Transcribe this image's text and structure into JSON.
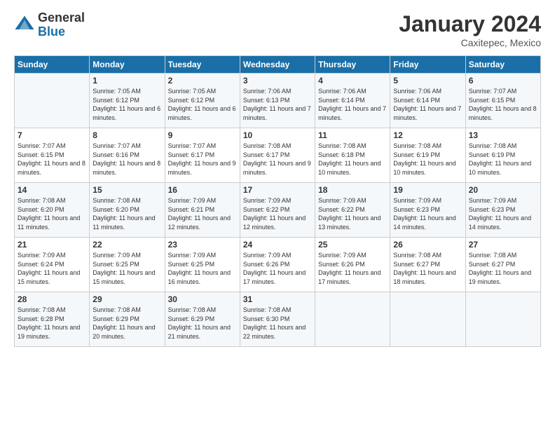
{
  "header": {
    "logo_general": "General",
    "logo_blue": "Blue",
    "month_title": "January 2024",
    "location": "Caxitepec, Mexico"
  },
  "weekdays": [
    "Sunday",
    "Monday",
    "Tuesday",
    "Wednesday",
    "Thursday",
    "Friday",
    "Saturday"
  ],
  "weeks": [
    [
      {
        "day": "",
        "sunrise": "",
        "sunset": "",
        "daylight": ""
      },
      {
        "day": "1",
        "sunrise": "Sunrise: 7:05 AM",
        "sunset": "Sunset: 6:12 PM",
        "daylight": "Daylight: 11 hours and 6 minutes."
      },
      {
        "day": "2",
        "sunrise": "Sunrise: 7:05 AM",
        "sunset": "Sunset: 6:12 PM",
        "daylight": "Daylight: 11 hours and 6 minutes."
      },
      {
        "day": "3",
        "sunrise": "Sunrise: 7:06 AM",
        "sunset": "Sunset: 6:13 PM",
        "daylight": "Daylight: 11 hours and 7 minutes."
      },
      {
        "day": "4",
        "sunrise": "Sunrise: 7:06 AM",
        "sunset": "Sunset: 6:14 PM",
        "daylight": "Daylight: 11 hours and 7 minutes."
      },
      {
        "day": "5",
        "sunrise": "Sunrise: 7:06 AM",
        "sunset": "Sunset: 6:14 PM",
        "daylight": "Daylight: 11 hours and 7 minutes."
      },
      {
        "day": "6",
        "sunrise": "Sunrise: 7:07 AM",
        "sunset": "Sunset: 6:15 PM",
        "daylight": "Daylight: 11 hours and 8 minutes."
      }
    ],
    [
      {
        "day": "7",
        "sunrise": "Sunrise: 7:07 AM",
        "sunset": "Sunset: 6:15 PM",
        "daylight": "Daylight: 11 hours and 8 minutes."
      },
      {
        "day": "8",
        "sunrise": "Sunrise: 7:07 AM",
        "sunset": "Sunset: 6:16 PM",
        "daylight": "Daylight: 11 hours and 8 minutes."
      },
      {
        "day": "9",
        "sunrise": "Sunrise: 7:07 AM",
        "sunset": "Sunset: 6:17 PM",
        "daylight": "Daylight: 11 hours and 9 minutes."
      },
      {
        "day": "10",
        "sunrise": "Sunrise: 7:08 AM",
        "sunset": "Sunset: 6:17 PM",
        "daylight": "Daylight: 11 hours and 9 minutes."
      },
      {
        "day": "11",
        "sunrise": "Sunrise: 7:08 AM",
        "sunset": "Sunset: 6:18 PM",
        "daylight": "Daylight: 11 hours and 10 minutes."
      },
      {
        "day": "12",
        "sunrise": "Sunrise: 7:08 AM",
        "sunset": "Sunset: 6:19 PM",
        "daylight": "Daylight: 11 hours and 10 minutes."
      },
      {
        "day": "13",
        "sunrise": "Sunrise: 7:08 AM",
        "sunset": "Sunset: 6:19 PM",
        "daylight": "Daylight: 11 hours and 10 minutes."
      }
    ],
    [
      {
        "day": "14",
        "sunrise": "Sunrise: 7:08 AM",
        "sunset": "Sunset: 6:20 PM",
        "daylight": "Daylight: 11 hours and 11 minutes."
      },
      {
        "day": "15",
        "sunrise": "Sunrise: 7:08 AM",
        "sunset": "Sunset: 6:20 PM",
        "daylight": "Daylight: 11 hours and 11 minutes."
      },
      {
        "day": "16",
        "sunrise": "Sunrise: 7:09 AM",
        "sunset": "Sunset: 6:21 PM",
        "daylight": "Daylight: 11 hours and 12 minutes."
      },
      {
        "day": "17",
        "sunrise": "Sunrise: 7:09 AM",
        "sunset": "Sunset: 6:22 PM",
        "daylight": "Daylight: 11 hours and 12 minutes."
      },
      {
        "day": "18",
        "sunrise": "Sunrise: 7:09 AM",
        "sunset": "Sunset: 6:22 PM",
        "daylight": "Daylight: 11 hours and 13 minutes."
      },
      {
        "day": "19",
        "sunrise": "Sunrise: 7:09 AM",
        "sunset": "Sunset: 6:23 PM",
        "daylight": "Daylight: 11 hours and 14 minutes."
      },
      {
        "day": "20",
        "sunrise": "Sunrise: 7:09 AM",
        "sunset": "Sunset: 6:23 PM",
        "daylight": "Daylight: 11 hours and 14 minutes."
      }
    ],
    [
      {
        "day": "21",
        "sunrise": "Sunrise: 7:09 AM",
        "sunset": "Sunset: 6:24 PM",
        "daylight": "Daylight: 11 hours and 15 minutes."
      },
      {
        "day": "22",
        "sunrise": "Sunrise: 7:09 AM",
        "sunset": "Sunset: 6:25 PM",
        "daylight": "Daylight: 11 hours and 15 minutes."
      },
      {
        "day": "23",
        "sunrise": "Sunrise: 7:09 AM",
        "sunset": "Sunset: 6:25 PM",
        "daylight": "Daylight: 11 hours and 16 minutes."
      },
      {
        "day": "24",
        "sunrise": "Sunrise: 7:09 AM",
        "sunset": "Sunset: 6:26 PM",
        "daylight": "Daylight: 11 hours and 17 minutes."
      },
      {
        "day": "25",
        "sunrise": "Sunrise: 7:09 AM",
        "sunset": "Sunset: 6:26 PM",
        "daylight": "Daylight: 11 hours and 17 minutes."
      },
      {
        "day": "26",
        "sunrise": "Sunrise: 7:08 AM",
        "sunset": "Sunset: 6:27 PM",
        "daylight": "Daylight: 11 hours and 18 minutes."
      },
      {
        "day": "27",
        "sunrise": "Sunrise: 7:08 AM",
        "sunset": "Sunset: 6:27 PM",
        "daylight": "Daylight: 11 hours and 19 minutes."
      }
    ],
    [
      {
        "day": "28",
        "sunrise": "Sunrise: 7:08 AM",
        "sunset": "Sunset: 6:28 PM",
        "daylight": "Daylight: 11 hours and 19 minutes."
      },
      {
        "day": "29",
        "sunrise": "Sunrise: 7:08 AM",
        "sunset": "Sunset: 6:29 PM",
        "daylight": "Daylight: 11 hours and 20 minutes."
      },
      {
        "day": "30",
        "sunrise": "Sunrise: 7:08 AM",
        "sunset": "Sunset: 6:29 PM",
        "daylight": "Daylight: 11 hours and 21 minutes."
      },
      {
        "day": "31",
        "sunrise": "Sunrise: 7:08 AM",
        "sunset": "Sunset: 6:30 PM",
        "daylight": "Daylight: 11 hours and 22 minutes."
      },
      {
        "day": "",
        "sunrise": "",
        "sunset": "",
        "daylight": ""
      },
      {
        "day": "",
        "sunrise": "",
        "sunset": "",
        "daylight": ""
      },
      {
        "day": "",
        "sunrise": "",
        "sunset": "",
        "daylight": ""
      }
    ]
  ]
}
